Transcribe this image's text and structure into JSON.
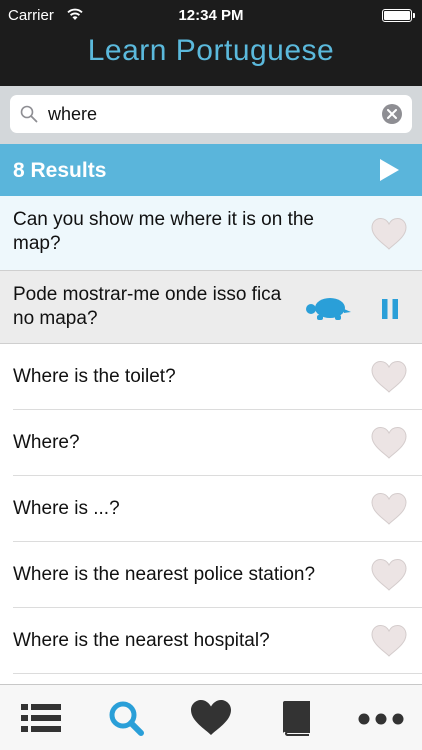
{
  "status": {
    "carrier": "Carrier",
    "time": "12:34 PM"
  },
  "header": {
    "title": "Learn Portuguese"
  },
  "search": {
    "value": "where"
  },
  "results": {
    "count_label": "8 Results"
  },
  "items": [
    {
      "text": "Can you show me where it is on the map?",
      "favorite": false
    },
    {
      "translation": "Pode mostrar-me onde isso fica no mapa?",
      "playing": true
    },
    {
      "text": "Where is the toilet?",
      "favorite": false
    },
    {
      "text": "Where?",
      "favorite": false
    },
    {
      "text": "Where is ...?",
      "favorite": false
    },
    {
      "text": "Where is the nearest police station?",
      "favorite": false
    },
    {
      "text": "Where is the nearest hospital?",
      "favorite": false
    }
  ],
  "tabs": [
    {
      "icon": "list-icon",
      "selected": false
    },
    {
      "icon": "search-icon",
      "selected": true
    },
    {
      "icon": "heart-icon",
      "selected": false
    },
    {
      "icon": "book-icon",
      "selected": false
    },
    {
      "icon": "more-icon",
      "selected": false
    }
  ],
  "colors": {
    "accent": "#5ab5db",
    "header_bg": "#1c1c1c",
    "title": "#5bb9dc",
    "heart": "#ece4e4"
  }
}
